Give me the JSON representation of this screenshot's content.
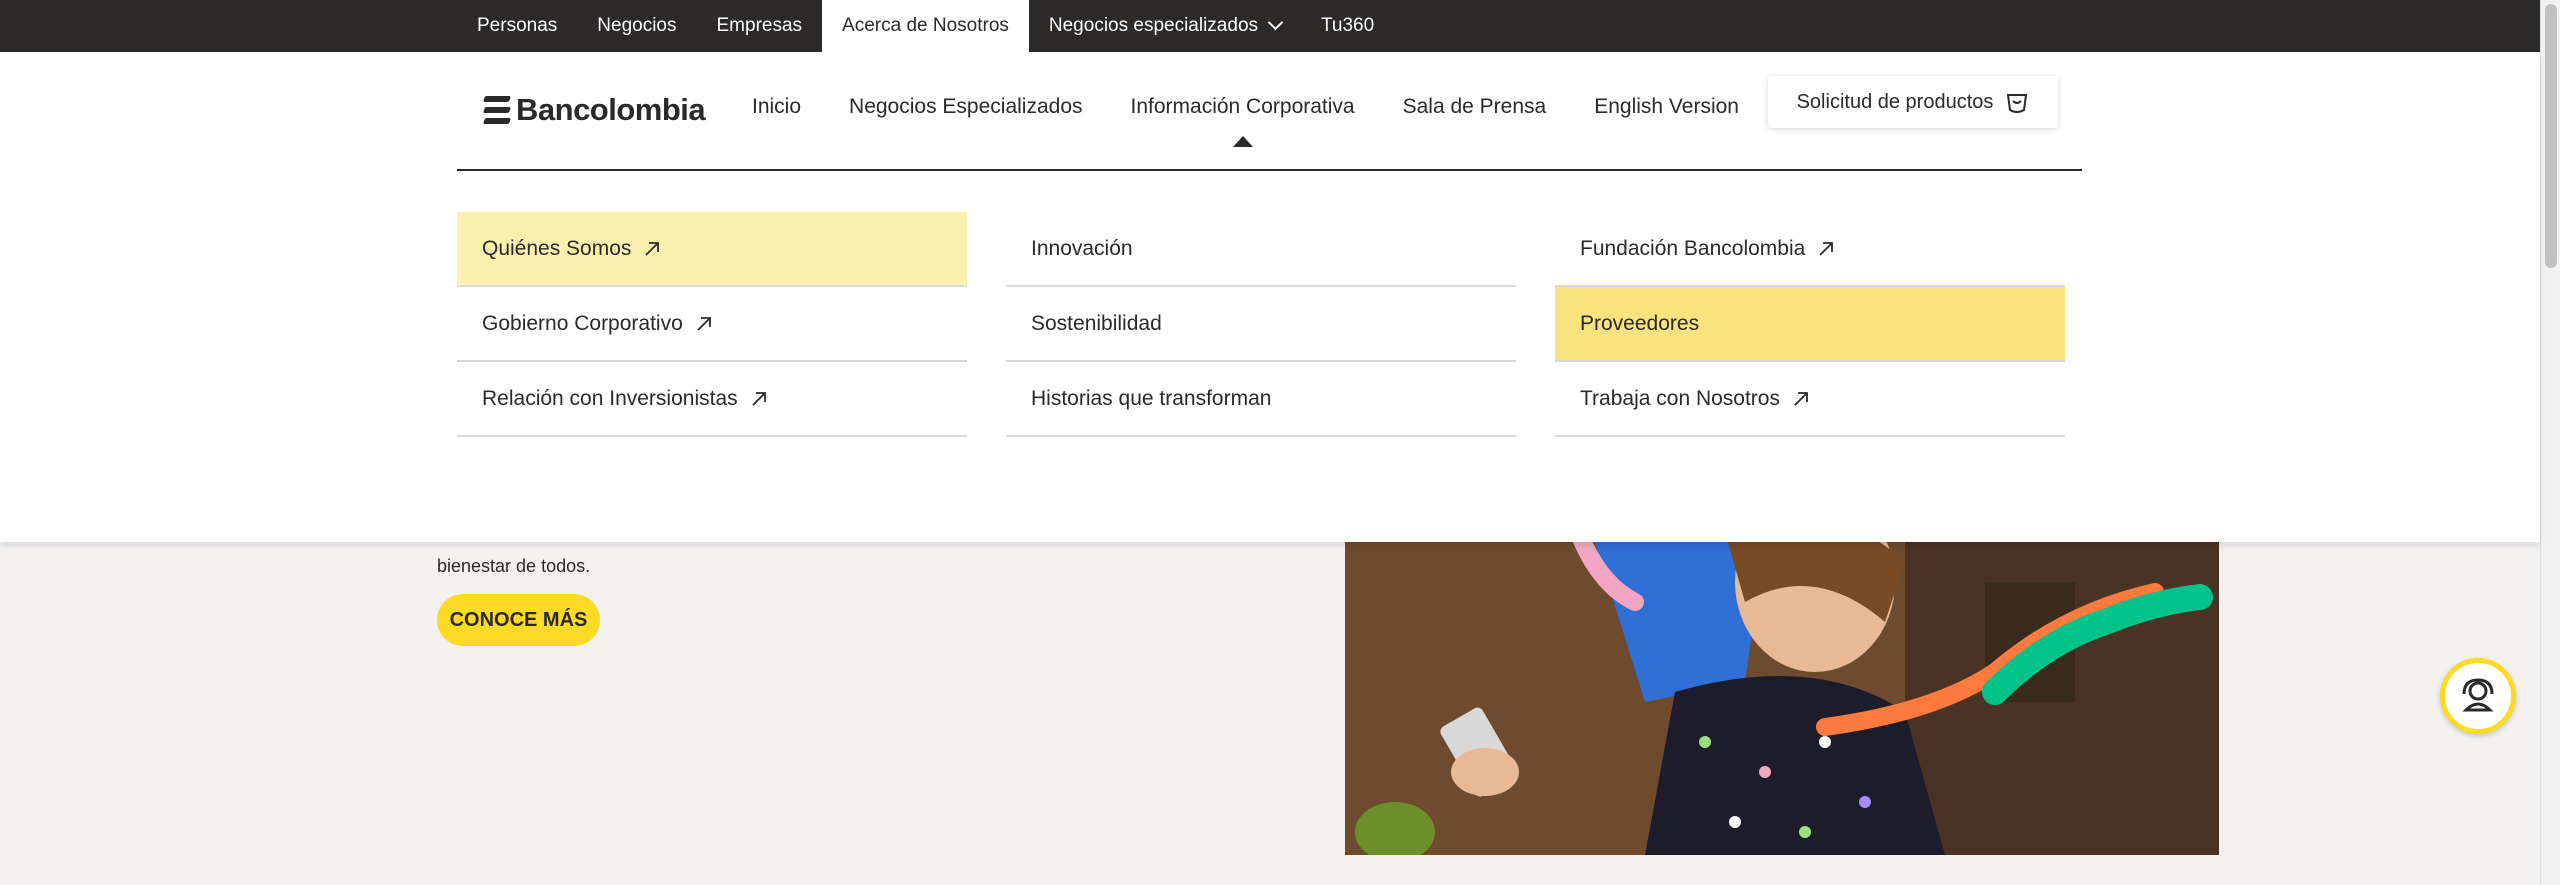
{
  "top_nav": {
    "items": [
      {
        "label": "Personas"
      },
      {
        "label": "Negocios"
      },
      {
        "label": "Empresas"
      },
      {
        "label": "Acerca de Nosotros",
        "active": true
      },
      {
        "label": "Negocios especializados",
        "has_dropdown": true
      },
      {
        "label": "Tu360"
      }
    ]
  },
  "header": {
    "logo_text": "Bancolombia",
    "nav": [
      {
        "label": "Inicio"
      },
      {
        "label": "Negocios Especializados"
      },
      {
        "label": "Información Corporativa",
        "active": true
      },
      {
        "label": "Sala de Prensa"
      },
      {
        "label": "English Version"
      }
    ],
    "solicitud_label": "Solicitud de productos"
  },
  "mega_menu": {
    "columns": [
      [
        {
          "label": "Quiénes Somos",
          "external": true
        },
        {
          "label": "Gobierno Corporativo",
          "external": true
        },
        {
          "label": "Relación con Inversionistas",
          "external": true
        }
      ],
      [
        {
          "label": "Innovación",
          "external": false
        },
        {
          "label": "Sostenibilidad",
          "external": false
        },
        {
          "label": "Historias que transforman",
          "external": false
        }
      ],
      [
        {
          "label": "Fundación Bancolombia",
          "external": true
        },
        {
          "label": "Proveedores",
          "external": false
        },
        {
          "label": "Trabaja con Nosotros",
          "external": true
        }
      ]
    ]
  },
  "hero": {
    "text_fragment": "bienestar de todos.",
    "cta_label": "CONOCE MÁS"
  },
  "colors": {
    "dark": "#2c2a29",
    "brand_yellow": "#fdda24",
    "highlight_light": "#fbf0ae",
    "highlight": "#f8e37e"
  },
  "icons": [
    "arrow-up-right-icon",
    "chevron-down-icon",
    "shopping-bag-icon",
    "chat-support-icon"
  ]
}
